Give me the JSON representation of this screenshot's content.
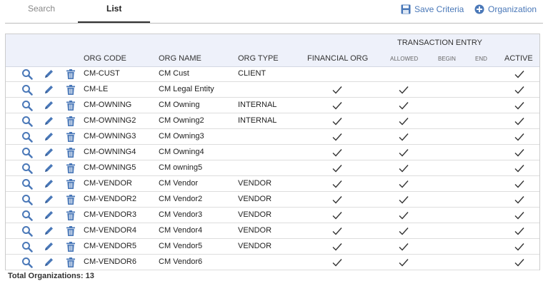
{
  "tabs": [
    {
      "label": "Search",
      "active": false
    },
    {
      "label": "List",
      "active": true
    }
  ],
  "actions": {
    "save_criteria": {
      "label": "Save Criteria",
      "icon": "floppy-disk-icon"
    },
    "organization": {
      "label": "Organization",
      "icon": "plus-circle-icon"
    }
  },
  "headers": {
    "group_label": "TRANSACTION ENTRY",
    "org_code": "ORG CODE",
    "org_name": "ORG NAME",
    "org_type": "ORG TYPE",
    "financial_org": "FINANCIAL ORG",
    "allowed": "ALLOWED",
    "begin": "BEGIN",
    "end": "END",
    "active": "ACTIVE"
  },
  "rows": [
    {
      "code": "CM-CUST",
      "name": "CM Cust",
      "type": "CLIENT",
      "financial": false,
      "allowed": false,
      "active": true
    },
    {
      "code": "CM-LE",
      "name": "CM Legal Entity",
      "type": "",
      "financial": true,
      "allowed": true,
      "active": true
    },
    {
      "code": "CM-OWNING",
      "name": "CM Owning",
      "type": "INTERNAL",
      "financial": true,
      "allowed": true,
      "active": true
    },
    {
      "code": "CM-OWNING2",
      "name": "CM Owning2",
      "type": "INTERNAL",
      "financial": true,
      "allowed": true,
      "active": true
    },
    {
      "code": "CM-OWNING3",
      "name": "CM Owning3",
      "type": "",
      "financial": true,
      "allowed": true,
      "active": true
    },
    {
      "code": "CM-OWNING4",
      "name": "CM Owning4",
      "type": "",
      "financial": true,
      "allowed": true,
      "active": true
    },
    {
      "code": "CM-OWNING5",
      "name": "CM owning5",
      "type": "",
      "financial": true,
      "allowed": true,
      "active": true
    },
    {
      "code": "CM-VENDOR",
      "name": "CM Vendor",
      "type": "VENDOR",
      "financial": true,
      "allowed": true,
      "active": true
    },
    {
      "code": "CM-VENDOR2",
      "name": "CM Vendor2",
      "type": "VENDOR",
      "financial": true,
      "allowed": true,
      "active": true
    },
    {
      "code": "CM-VENDOR3",
      "name": "CM Vendor3",
      "type": "VENDOR",
      "financial": true,
      "allowed": true,
      "active": true
    },
    {
      "code": "CM-VENDOR4",
      "name": "CM Vendor4",
      "type": "VENDOR",
      "financial": true,
      "allowed": true,
      "active": true
    },
    {
      "code": "CM-VENDOR5",
      "name": "CM Vendor5",
      "type": "VENDOR",
      "financial": true,
      "allowed": true,
      "active": true
    },
    {
      "code": "CM-VENDOR6",
      "name": "CM Vendor6",
      "type": "",
      "financial": true,
      "allowed": true,
      "active": true
    }
  ],
  "row_icons": [
    "magnifier-icon",
    "pencil-icon",
    "trash-icon"
  ],
  "footer": {
    "total_label": "Total Organizations: 13"
  },
  "colors": {
    "accent": "#4a78b8",
    "header_bg": "#eef1fa"
  }
}
